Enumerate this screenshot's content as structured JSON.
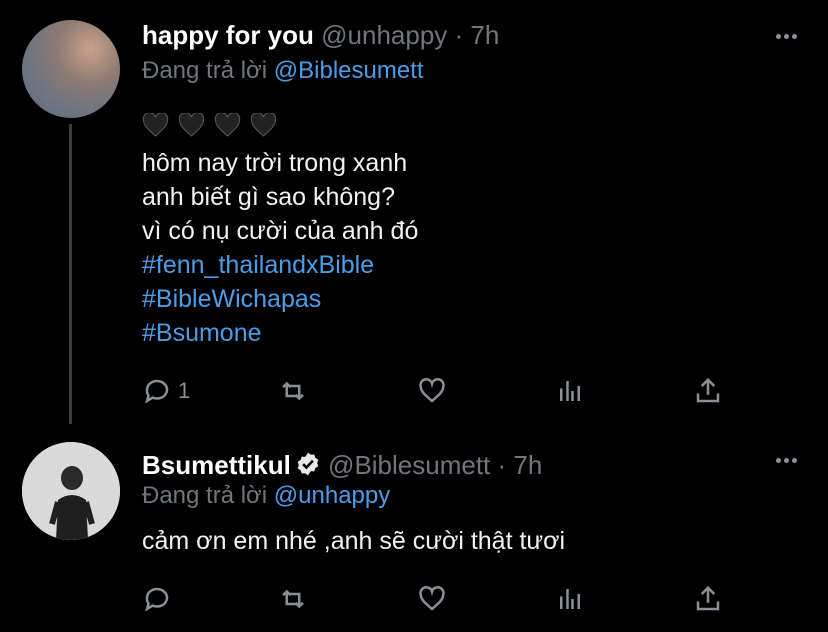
{
  "tweets": [
    {
      "name": "happy for you",
      "handle": "@unhappy",
      "time": "· 7h",
      "reply_prefix": "Đang trả lời",
      "reply_to": "@Biblesumett",
      "emoji": "🖤🖤🖤🖤",
      "lines": [
        "hôm nay trời trong xanh",
        "anh biết gì sao không?",
        "vì có nụ cười của anh đó"
      ],
      "hashtags": [
        "#fenn_thailandxBible",
        "#BibleWichapas",
        "#Bsumone"
      ],
      "reply_count": "1"
    },
    {
      "name": "Bsumettikul",
      "handle": "@Biblesumett",
      "time": "· 7h",
      "reply_prefix": "Đang trả lời",
      "reply_to": "@unhappy",
      "lines": [
        "cảm ơn em nhé ,anh sẽ cười thật tươi"
      ],
      "reply_count": ""
    }
  ],
  "icons": [
    "more-icon",
    "reply-icon",
    "retweet-icon",
    "like-icon",
    "analytics-icon",
    "share-icon",
    "verified-icon",
    "black-heart-icon"
  ],
  "colors": {
    "background": "#000000",
    "link": "#4a9ee8",
    "muted": "#71767b"
  }
}
